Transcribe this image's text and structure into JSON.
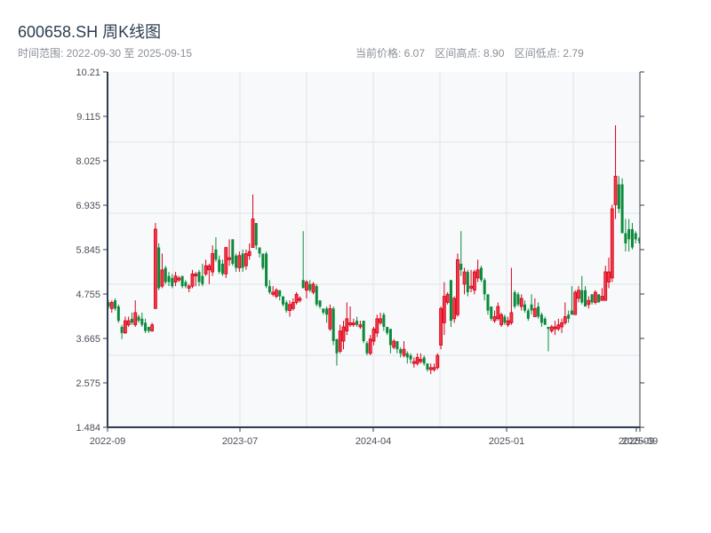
{
  "header": {
    "title": "600658.SH 周K线图",
    "range_label": "时间范围: 2022-09-30 至 2025-09-15",
    "current_price": "当前价格: 6.07",
    "range_high": "区间高点: 8.90",
    "range_low": "区间低点: 2.79"
  },
  "colors": {
    "up": "#d9001b",
    "up_fill": "#ee3a46",
    "down": "#0a8a3a",
    "axis": "#2f3e4e",
    "grid": "#e2e5e9",
    "plot_bg": "#f7f9fb"
  },
  "chart_data": {
    "type": "candlestick",
    "title": "600658.SH 周K线图",
    "ylim": [
      1.484,
      10.21
    ],
    "y_ticks": [
      "10.21",
      "9.115",
      "8.025",
      "6.935",
      "5.845",
      "4.755",
      "3.665",
      "2.575",
      "1.484"
    ],
    "x_ticks": [
      "2022-09",
      "2023-07",
      "2024-04",
      "2025-01",
      "2025-09",
      "2025-09"
    ],
    "grid": true,
    "up_color": "red",
    "down_color": "green",
    "ohlc_fields": [
      "open",
      "close",
      "low",
      "high"
    ],
    "candles": [
      [
        4.55,
        4.45,
        4.4,
        4.6
      ],
      [
        4.4,
        4.55,
        4.3,
        4.6
      ],
      [
        4.6,
        4.4,
        4.35,
        4.65
      ],
      [
        4.45,
        4.1,
        4.05,
        4.5
      ],
      [
        3.95,
        3.8,
        3.65,
        4.0
      ],
      [
        3.8,
        4.1,
        3.78,
        4.2
      ],
      [
        4.0,
        4.1,
        3.95,
        4.2
      ],
      [
        4.15,
        4.05,
        4.0,
        4.3
      ],
      [
        4.0,
        4.3,
        3.95,
        4.6
      ],
      [
        4.2,
        4.1,
        4.05,
        4.25
      ],
      [
        4.15,
        4.0,
        3.95,
        4.3
      ],
      [
        4.05,
        3.85,
        3.8,
        4.15
      ],
      [
        3.95,
        3.85,
        3.8,
        3.95
      ],
      [
        3.85,
        4.0,
        3.83,
        4.05
      ],
      [
        4.4,
        6.35,
        4.4,
        6.5
      ],
      [
        5.9,
        4.9,
        4.85,
        6.0
      ],
      [
        4.95,
        5.35,
        4.9,
        5.75
      ],
      [
        5.4,
        5.05,
        5.0,
        5.45
      ],
      [
        5.2,
        5.05,
        4.95,
        5.3
      ],
      [
        5.15,
        4.95,
        4.9,
        5.25
      ],
      [
        5.05,
        5.2,
        4.95,
        5.3
      ],
      [
        5.1,
        5.15,
        5.05,
        5.2
      ],
      [
        5.2,
        4.95,
        4.9,
        5.2
      ],
      [
        5.05,
        4.95,
        4.9,
        5.1
      ],
      [
        4.9,
        4.95,
        4.8,
        5.0
      ],
      [
        4.95,
        5.25,
        4.9,
        5.35
      ],
      [
        5.2,
        5.25,
        4.95,
        5.3
      ],
      [
        5.3,
        5.05,
        4.95,
        5.35
      ],
      [
        5.2,
        5.0,
        4.95,
        5.5
      ],
      [
        5.25,
        5.45,
        5.2,
        5.6
      ],
      [
        5.35,
        5.45,
        5.0,
        5.5
      ],
      [
        5.3,
        5.75,
        5.2,
        5.95
      ],
      [
        5.85,
        5.6,
        5.55,
        6.15
      ],
      [
        5.6,
        5.3,
        5.25,
        5.7
      ],
      [
        5.5,
        5.25,
        5.2,
        5.6
      ],
      [
        5.25,
        5.9,
        5.15,
        5.9
      ],
      [
        5.6,
        5.65,
        5.45,
        6.1
      ],
      [
        6.1,
        5.5,
        5.45,
        6.1
      ],
      [
        5.7,
        5.4,
        5.3,
        5.75
      ],
      [
        5.4,
        5.7,
        5.3,
        5.8
      ],
      [
        5.75,
        5.4,
        5.3,
        5.85
      ],
      [
        5.45,
        5.75,
        5.35,
        5.85
      ],
      [
        5.7,
        5.8,
        5.6,
        6.0
      ],
      [
        5.9,
        6.6,
        5.9,
        7.2
      ],
      [
        6.5,
        5.95,
        5.85,
        6.5
      ],
      [
        5.9,
        5.75,
        5.65,
        5.9
      ],
      [
        5.75,
        5.4,
        5.35,
        5.75
      ],
      [
        5.75,
        4.95,
        4.9,
        5.8
      ],
      [
        4.95,
        4.8,
        4.75,
        5.1
      ],
      [
        4.75,
        4.8,
        4.7,
        4.95
      ],
      [
        4.7,
        4.85,
        4.65,
        4.9
      ],
      [
        4.85,
        4.7,
        4.6,
        4.85
      ],
      [
        4.7,
        4.5,
        4.45,
        4.7
      ],
      [
        4.55,
        4.35,
        4.3,
        4.6
      ],
      [
        4.35,
        4.5,
        4.2,
        4.6
      ],
      [
        4.4,
        4.55,
        4.35,
        4.65
      ],
      [
        4.55,
        4.75,
        4.5,
        4.8
      ],
      [
        4.6,
        4.65,
        4.55,
        4.7
      ],
      [
        5.1,
        4.9,
        4.9,
        6.3
      ],
      [
        4.85,
        5.05,
        4.65,
        5.1
      ],
      [
        5.0,
        4.85,
        4.8,
        5.1
      ],
      [
        4.8,
        5.0,
        4.75,
        5.05
      ],
      [
        4.95,
        4.5,
        4.45,
        5.0
      ],
      [
        4.6,
        4.45,
        4.4,
        4.6
      ],
      [
        4.4,
        4.3,
        4.25,
        4.4
      ],
      [
        4.4,
        4.25,
        4.05,
        4.45
      ],
      [
        3.9,
        4.4,
        3.85,
        4.5
      ],
      [
        4.4,
        3.6,
        3.5,
        4.45
      ],
      [
        3.65,
        3.3,
        3.0,
        3.65
      ],
      [
        3.35,
        3.85,
        3.3,
        4.0
      ],
      [
        3.6,
        3.95,
        3.4,
        4.1
      ],
      [
        3.85,
        4.15,
        3.75,
        4.55
      ],
      [
        4.0,
        4.05,
        3.95,
        4.45
      ],
      [
        4.0,
        4.05,
        3.95,
        4.15
      ],
      [
        4.1,
        4.0,
        3.95,
        4.2
      ],
      [
        3.95,
        4.0,
        3.9,
        4.1
      ],
      [
        4.1,
        3.6,
        3.55,
        4.1
      ],
      [
        3.55,
        3.3,
        3.25,
        3.6
      ],
      [
        3.3,
        3.65,
        3.25,
        3.75
      ],
      [
        3.6,
        3.9,
        3.5,
        3.95
      ],
      [
        3.8,
        4.15,
        3.7,
        4.25
      ],
      [
        4.05,
        4.15,
        4.0,
        4.3
      ],
      [
        4.25,
        3.95,
        3.85,
        4.3
      ],
      [
        3.95,
        3.8,
        3.75,
        3.95
      ],
      [
        3.9,
        3.5,
        3.3,
        3.9
      ],
      [
        3.45,
        3.6,
        3.4,
        3.65
      ],
      [
        3.6,
        3.4,
        3.3,
        3.6
      ],
      [
        3.4,
        3.3,
        3.2,
        3.45
      ],
      [
        3.25,
        3.4,
        3.2,
        3.6
      ],
      [
        3.3,
        3.2,
        3.05,
        3.35
      ],
      [
        3.25,
        3.15,
        3.05,
        3.3
      ],
      [
        3.05,
        3.1,
        2.95,
        3.2
      ],
      [
        3.05,
        3.2,
        3.0,
        3.3
      ],
      [
        3.1,
        3.15,
        3.05,
        3.3
      ],
      [
        3.2,
        3.05,
        3.0,
        3.25
      ],
      [
        3.05,
        2.9,
        2.85,
        3.05
      ],
      [
        2.9,
        2.95,
        2.79,
        3.05
      ],
      [
        2.9,
        2.95,
        2.85,
        3.05
      ],
      [
        2.95,
        3.25,
        2.9,
        3.3
      ],
      [
        3.5,
        4.4,
        3.4,
        4.45
      ],
      [
        4.05,
        4.7,
        3.75,
        5.05
      ],
      [
        4.55,
        4.75,
        4.5,
        4.8
      ],
      [
        5.1,
        4.1,
        3.95,
        5.1
      ],
      [
        4.15,
        4.65,
        4.05,
        4.7
      ],
      [
        4.25,
        5.6,
        4.2,
        5.75
      ],
      [
        5.5,
        5.35,
        5.2,
        6.3
      ],
      [
        5.0,
        5.3,
        4.75,
        5.4
      ],
      [
        5.3,
        4.8,
        4.7,
        5.35
      ],
      [
        4.9,
        4.95,
        4.8,
        5.35
      ],
      [
        4.85,
        5.3,
        4.75,
        5.35
      ],
      [
        5.15,
        5.35,
        5.05,
        5.6
      ],
      [
        5.4,
        5.1,
        5.05,
        5.45
      ],
      [
        5.1,
        4.75,
        4.6,
        5.15
      ],
      [
        4.75,
        4.35,
        4.25,
        4.75
      ],
      [
        4.45,
        4.15,
        4.1,
        4.45
      ],
      [
        4.1,
        4.2,
        4.05,
        4.35
      ],
      [
        4.15,
        4.45,
        4.1,
        4.55
      ],
      [
        4.0,
        4.25,
        3.95,
        4.3
      ],
      [
        4.2,
        4.05,
        4.0,
        4.25
      ],
      [
        4.0,
        4.1,
        3.95,
        4.2
      ],
      [
        4.05,
        4.3,
        4.0,
        5.4
      ],
      [
        4.8,
        4.45,
        4.4,
        4.85
      ],
      [
        4.75,
        4.5,
        4.45,
        4.8
      ],
      [
        4.45,
        4.65,
        4.35,
        4.75
      ],
      [
        4.5,
        4.35,
        4.3,
        4.6
      ],
      [
        4.35,
        4.15,
        4.1,
        4.4
      ],
      [
        4.5,
        4.35,
        4.25,
        4.75
      ],
      [
        4.2,
        4.4,
        4.2,
        4.65
      ],
      [
        4.45,
        4.2,
        4.15,
        4.55
      ],
      [
        4.25,
        4.05,
        3.95,
        4.3
      ],
      [
        4.15,
        4.0,
        4.0,
        4.2
      ],
      [
        3.95,
        3.9,
        3.35,
        3.95
      ],
      [
        3.85,
        3.95,
        3.8,
        4.0
      ],
      [
        3.9,
        3.95,
        3.75,
        4.1
      ],
      [
        3.9,
        4.0,
        3.85,
        4.15
      ],
      [
        3.95,
        4.05,
        3.8,
        4.15
      ],
      [
        4.05,
        4.2,
        4.0,
        4.55
      ],
      [
        4.25,
        4.15,
        4.05,
        4.35
      ],
      [
        4.35,
        4.25,
        4.25,
        4.95
      ],
      [
        4.25,
        4.8,
        4.25,
        4.85
      ],
      [
        4.65,
        4.85,
        4.55,
        4.95
      ],
      [
        4.85,
        4.55,
        4.5,
        5.2
      ],
      [
        4.85,
        4.45,
        4.45,
        4.95
      ],
      [
        4.5,
        4.6,
        4.4,
        4.7
      ],
      [
        4.75,
        4.55,
        4.5,
        4.75
      ],
      [
        4.55,
        4.8,
        4.5,
        4.85
      ],
      [
        4.75,
        4.55,
        4.55,
        4.75
      ],
      [
        4.6,
        4.7,
        4.6,
        4.9
      ],
      [
        4.6,
        5.3,
        4.6,
        5.45
      ],
      [
        5.05,
        5.3,
        4.9,
        5.65
      ],
      [
        5.15,
        6.85,
        5.05,
        6.95
      ],
      [
        6.95,
        7.65,
        6.6,
        8.9
      ],
      [
        7.45,
        6.85,
        6.75,
        7.65
      ],
      [
        7.45,
        6.25,
        6.25,
        7.6
      ],
      [
        6.25,
        6.0,
        5.8,
        6.6
      ],
      [
        6.35,
        6.1,
        5.8,
        6.6
      ],
      [
        6.35,
        5.9,
        5.85,
        6.5
      ],
      [
        6.25,
        6.1,
        6.0,
        6.3
      ],
      [
        6.1,
        6.07,
        6.0,
        6.15
      ]
    ]
  }
}
